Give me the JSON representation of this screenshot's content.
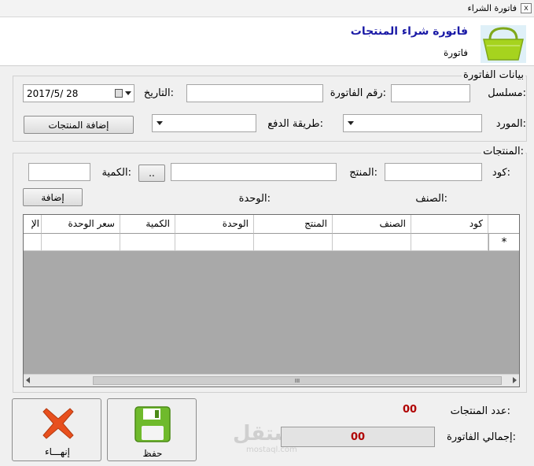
{
  "window": {
    "title": "فاتورة الشراء",
    "close_glyph": "x"
  },
  "header": {
    "title": "فاتورة شراء المنتجات",
    "subtitle": "فاتورة",
    "icon": "basket-icon"
  },
  "invoice_group": {
    "legend": "بيانات الفاتورة",
    "serial_label": "مسلسل:",
    "serial_value": "",
    "invoice_number_label": "رقم الفاتورة:",
    "invoice_number_value": "",
    "date_label": "التاريخ:",
    "date_value": "2017/5/  28",
    "supplier_label": "المورد:",
    "payment_method_label": "طريقة الدفع:",
    "add_products_button": "إضافة المنتجات"
  },
  "products_group": {
    "legend": "المنتجات:",
    "code_label": "كود:",
    "product_label": "المنتج:",
    "browse_button": "..",
    "quantity_label": "الكمية:",
    "category_label": "الصنف:",
    "unit_label": "الوحدة:",
    "add_button": "إضافة"
  },
  "grid": {
    "columns": [
      "كود",
      "الصنف",
      "المنتج",
      "الوحدة",
      "الكمية",
      "سعر الوحدة",
      "الإ"
    ],
    "new_row_marker": "*",
    "scroll_thumb_glyph": "III",
    "rows": []
  },
  "footer": {
    "close_button": "إنهـــاء",
    "save_button": "حفظ",
    "product_count_label": "عدد المنتجات:",
    "product_count_value": "00",
    "invoice_total_label": "إجمالي الفاتورة:",
    "invoice_total_value": "00",
    "watermark": "مستقل",
    "watermark_url": "mostaql.com"
  },
  "colors": {
    "accent_title": "#1a1aa6",
    "value_red": "#b00000",
    "grid_background": "#a9a9a9",
    "basket_green": "#a6d31e",
    "close_red": "#e8501e",
    "save_green": "#6fba2c"
  }
}
